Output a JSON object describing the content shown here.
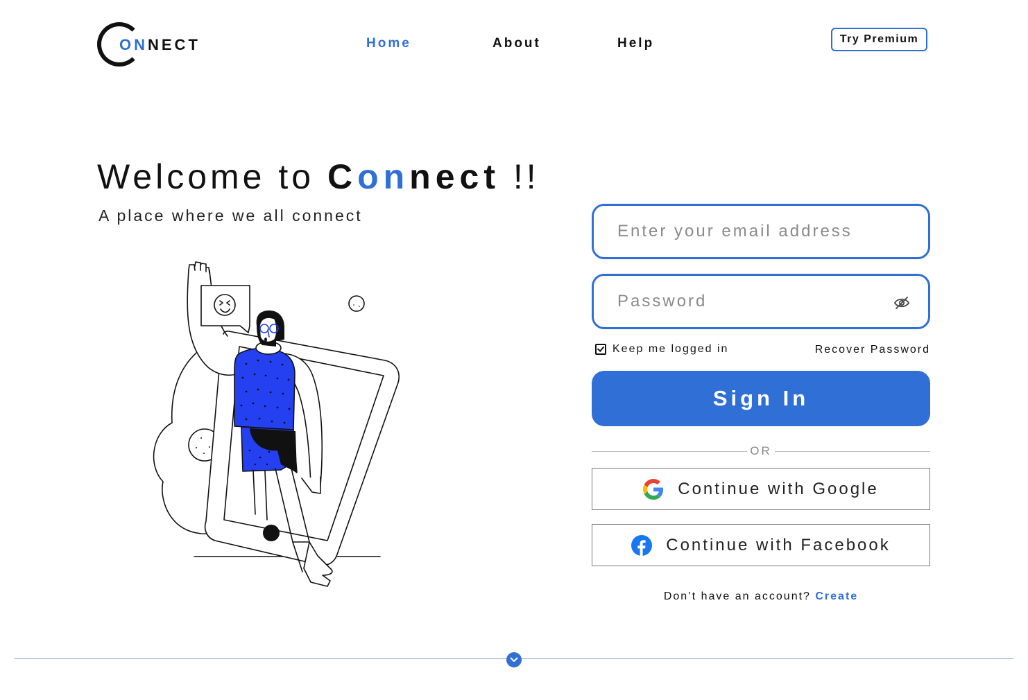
{
  "header": {
    "logo": {
      "letter": "C",
      "on": "ON",
      "rest": "NECT"
    },
    "nav": [
      {
        "label": "Home",
        "active": true
      },
      {
        "label": "About",
        "active": false
      },
      {
        "label": "Help",
        "active": false
      }
    ],
    "premium_label": "Try Premium"
  },
  "hero": {
    "welcome_prefix": "Welcome to ",
    "brand_c": "C",
    "brand_on": "on",
    "brand_rest": "nect",
    "welcome_suffix": " !!",
    "tagline": "A place where we all connect",
    "illustration_icon": "person-waving-from-phone-illustration"
  },
  "form": {
    "email_placeholder": "Enter your email address",
    "password_placeholder": "Password",
    "password_toggle_icon": "eye-slash-icon",
    "keep_logged_in_label": "Keep me logged in",
    "keep_logged_in_checked": true,
    "recover_label": "Recover Password",
    "signin_label": "Sign In",
    "or_label": "OR",
    "google_label": "Continue with Google",
    "google_icon": "google-icon",
    "facebook_label": "Continue with Facebook",
    "facebook_icon": "facebook-icon",
    "no_account_text": "Don’t have an account? ",
    "create_label": "Create"
  },
  "footer": {
    "scroll_icon": "chevron-down-icon"
  },
  "colors": {
    "accent": "#2f6fd6",
    "text": "#111111",
    "illustration_blue": "#2540f0"
  }
}
